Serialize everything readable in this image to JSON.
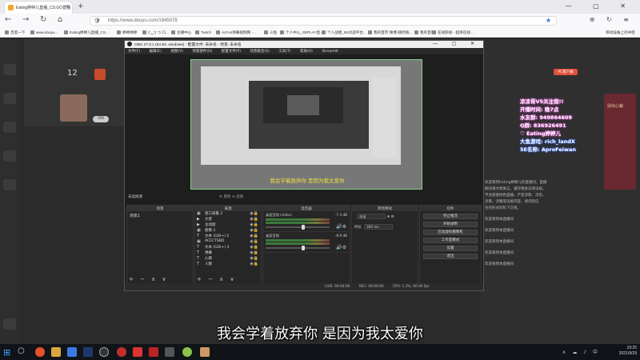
{
  "browser": {
    "tab_title": "Eating婷婷儿直播_CS:GO直播",
    "new_tab": "+",
    "window_controls": "—  ▢  ✕",
    "url": "https://www.douyu.com/1945078",
    "right_icons": "⊕ ↻ ≡",
    "bookmarks": [
      "百度一下",
      "www.douyu...",
      "Eating婷婷儿直播_CS...",
      "婷婷婷婷",
      "(*‿*) つ ロ...",
      "主播中心",
      "Twitch",
      "AcFun弹幕视频网 -...",
      "斗鱼",
      "个人中心_SEPLAY直...",
      "个人战绩_5E对战平台...",
      "我的首页 微博-随时随...",
      "我的首页",
      "在线影视 - 超清在线..."
    ],
    "mobile_bookmarks": "移动设备上的书签"
  },
  "douyu": {
    "rank_num": "12",
    "pc_btn": "PC客户端",
    "vip_pill": "V99",
    "overlay_lines": [
      {
        "text": "凉凉哥V5关注我!!",
        "style": "pink"
      },
      {
        "text": "开播时间: 晚7点",
        "style": "pink"
      },
      {
        "text": "水友群: 949864609",
        "style": "pink"
      },
      {
        "text": "Q群: 836926491",
        "style": "pink"
      },
      {
        "text": "♡ Eating婷婷儿",
        "style": "pink"
      },
      {
        "text": "大鱼游戏: rich_landX",
        "style": "blue"
      },
      {
        "text": "5E名称: AproFeiwan",
        "style": "blue"
      }
    ],
    "chat_lines": [
      "欢迎来到Eating婷婷儿的直播间，直播",
      "期间请文明发言，遵守相关法律法规。",
      "平台提倡绿色直播，严禁涉政、涉恐、",
      "涉黄、涉赌等违规内容，请勿轻信",
      "任何形式的私下交易。",
      "欢迎来到本直播间",
      "欢迎来到本直播间",
      "欢迎来到本直播间",
      "欢迎来到本直播间",
      "欢迎来到本直播间"
    ],
    "banner_text": "别出心裁"
  },
  "obs": {
    "title": "OBS 27.0.1 (64-bit, windows) - 配置文件: 未命名 - 场景: 未命名",
    "window_controls": "—  ▢  ✕",
    "menu": [
      "文件(F)",
      "编辑(E)",
      "视图(V)",
      "停靠部件(D)",
      "配置文件(P)",
      "场景集合(S)",
      "工具(T)",
      "帮助(H)",
      "Streamlit"
    ],
    "preview_subtitle": "我会学着放弃你 是因为我太爱你",
    "no_source": "未选择源",
    "props_label": "⚙ 属性   ⊘ 滤镜",
    "panels": {
      "scenes": "场景",
      "sources": "来源",
      "mixer": "混音器",
      "transitions": "转场特效",
      "controls": "控件"
    },
    "scene_items": [
      "场景1"
    ],
    "sources": [
      {
        "icon": "▣",
        "label": "窗口采集 2"
      },
      {
        "icon": "▶",
        "label": "大佬"
      },
      {
        "icon": "▶",
        "label": "主动窗"
      },
      {
        "icon": "▣",
        "label": "图像 2"
      },
      {
        "icon": "T",
        "label": "文本 (GDI+) 2"
      },
      {
        "icon": "▣",
        "label": "ACECTSBD"
      },
      {
        "icon": "T",
        "label": "文本 (GDI+) 3"
      },
      {
        "icon": "T",
        "label": "弹幕"
      },
      {
        "icon": "T",
        "label": "心跳"
      },
      {
        "icon": "T",
        "label": "人数"
      }
    ],
    "mixer_rows": [
      {
        "name": "桌面音频 (video)",
        "db": "-7.3 dB"
      },
      {
        "name": "桌面音频",
        "db": "-8.9 dB"
      }
    ],
    "transition": {
      "type_label": "淡出",
      "duration_label": "时长",
      "duration": "300 ms"
    },
    "controls": [
      "停止推流",
      "开始录制",
      "启动虚拟摄像机",
      "工作室模式",
      "设置",
      "退出"
    ],
    "footer_buttons": "+ − ∧ ∨",
    "status": [
      "LIVE: 00:00:00",
      "REC: 00:00:00",
      "CPU: 1.3%, 60.00 fps"
    ]
  },
  "subtitle": "我会学着放弃你 是因为我太爱你",
  "taskbar": {
    "start": "⊞",
    "search": "○",
    "time": "19:25",
    "date": "2021/9/29",
    "tray_icons": "∧ ☁ ♪ 中"
  }
}
